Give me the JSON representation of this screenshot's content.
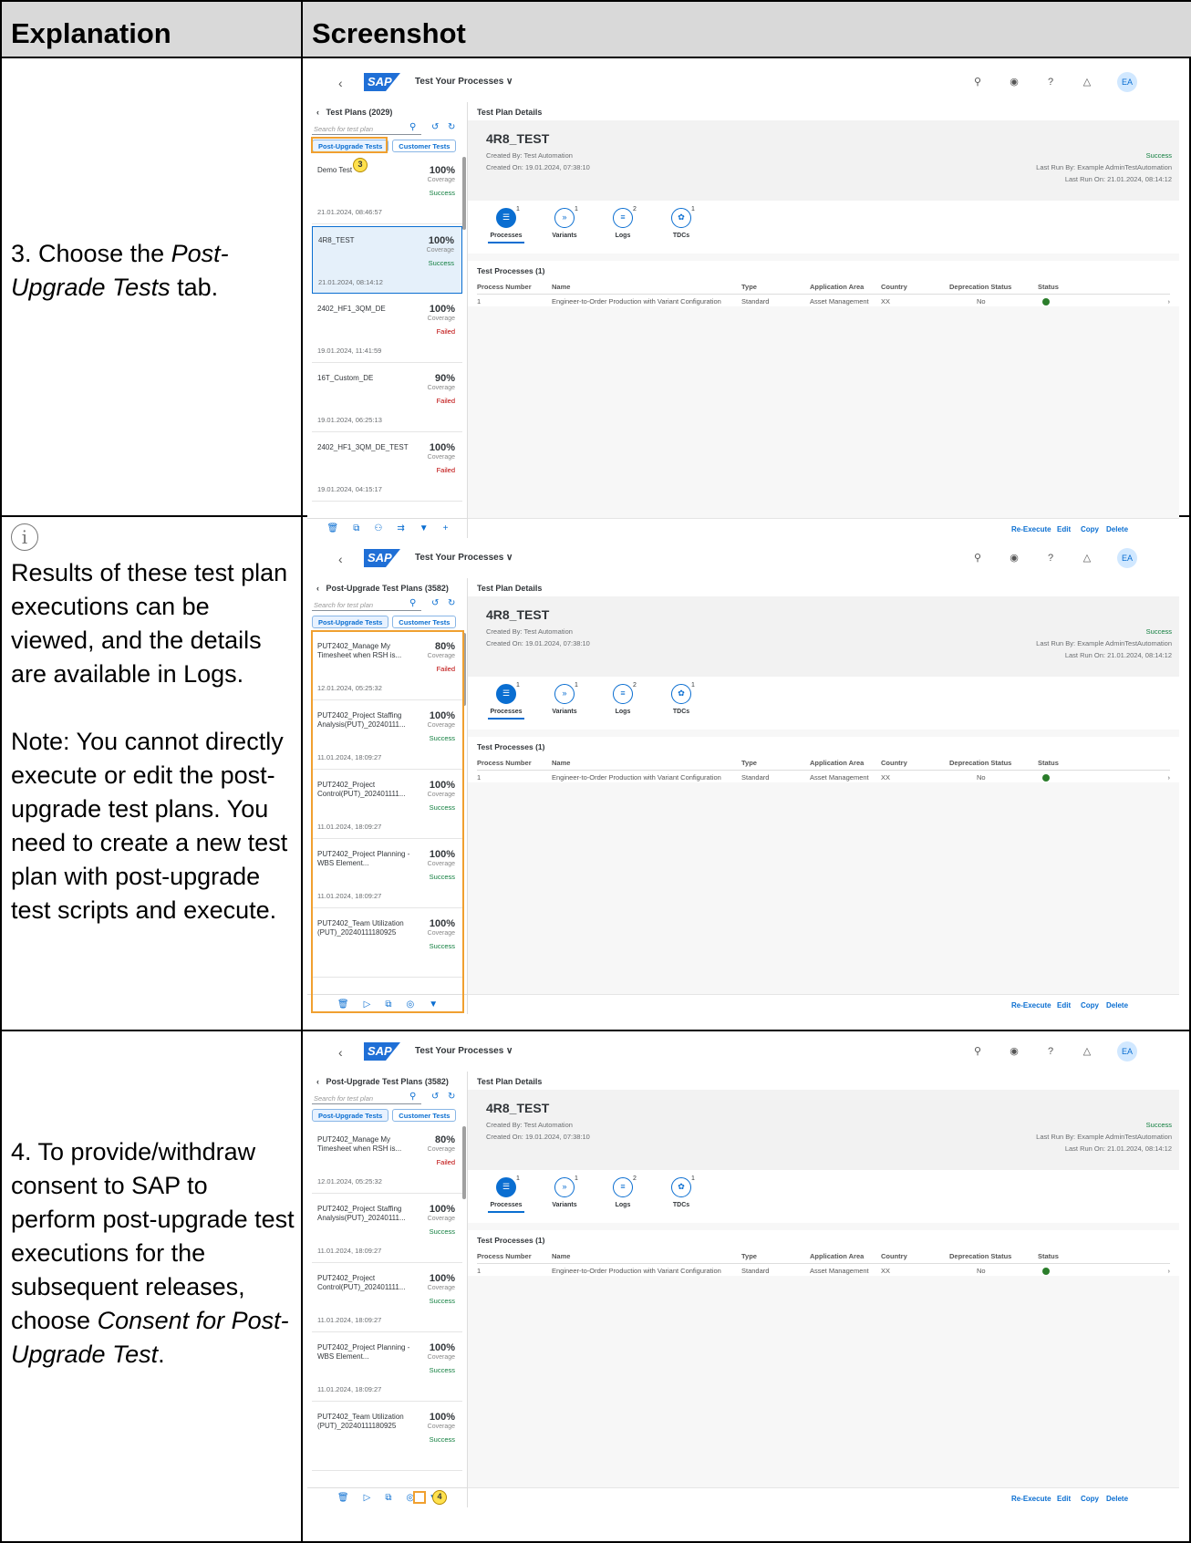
{
  "header": {
    "explanation": "Explanation",
    "screenshot": "Screenshot"
  },
  "rows": [
    {
      "step_prefix": "3. Choose the ",
      "step_em": "Post-Upgrade Tests",
      "step_suffix": " tab."
    },
    {
      "info_icon": "info-icon",
      "p1": "Results of these test plan executions can be viewed, and the details are available in Logs.",
      "p2": "Note: You cannot directly execute or edit the post-upgrade test plans. You need to create a new test plan with post-upgrade test scripts and execute."
    },
    {
      "step_prefix": "4. To provide/withdraw consent to SAP to perform post-upgrade test executions for the subsequent releases, choose ",
      "step_em": "Consent for Post-Upgrade Test",
      "step_suffix": "."
    }
  ],
  "shell": {
    "logo": "SAP",
    "app": "Test Your Processes ∨",
    "avatar": "EA"
  },
  "shot1": {
    "list_title": "Test Plans (2029)",
    "search_placeholder": "Search for test plan",
    "tab1": "Post-Upgrade Tests",
    "tab2": "Customer Tests",
    "callout": "3",
    "items": [
      {
        "name": "Demo Test",
        "pct": "100%",
        "cov": "Coverage",
        "status": "Success",
        "date": "21.01.2024, 08:46:57"
      },
      {
        "name": "4R8_TEST",
        "pct": "100%",
        "cov": "Coverage",
        "status": "Success",
        "date": "21.01.2024, 08:14:12"
      },
      {
        "name": "2402_HF1_3QM_DE",
        "pct": "100%",
        "cov": "Coverage",
        "status": "Failed",
        "date": "19.01.2024, 11:41:59"
      },
      {
        "name": "16T_Custom_DE",
        "pct": "90%",
        "cov": "Coverage",
        "status": "Failed",
        "date": "19.01.2024, 06:25:13"
      },
      {
        "name": "2402_HF1_3QM_DE_TEST",
        "pct": "100%",
        "cov": "Coverage",
        "status": "Failed",
        "date": "19.01.2024, 04:15:17"
      }
    ]
  },
  "shot2": {
    "list_title": "Post-Upgrade Test Plans (3582)",
    "search_placeholder": "Search for test plan",
    "tab1": "Post-Upgrade Tests",
    "tab2": "Customer Tests",
    "callout": "4",
    "items": [
      {
        "name": "PUT2402_Manage My Timesheet when RSH is...",
        "pct": "80%",
        "cov": "Coverage",
        "status": "Failed",
        "date": "12.01.2024, 05:25:32"
      },
      {
        "name": "PUT2402_Project Staffing Analysis(PUT)_20240111...",
        "pct": "100%",
        "cov": "Coverage",
        "status": "Success",
        "date": "11.01.2024, 18:09:27"
      },
      {
        "name": "PUT2402_Project Control(PUT)_202401111...",
        "pct": "100%",
        "cov": "Coverage",
        "status": "Success",
        "date": "11.01.2024, 18:09:27"
      },
      {
        "name": "PUT2402_Project Planning - WBS Element...",
        "pct": "100%",
        "cov": "Coverage",
        "status": "Success",
        "date": "11.01.2024, 18:09:27"
      },
      {
        "name": "PUT2402_Team Utilization (PUT)_20240111180925",
        "pct": "100%",
        "cov": "Coverage",
        "status": "Success",
        "date": ""
      }
    ]
  },
  "details": {
    "header": "Test Plan Details",
    "title": "4R8_TEST",
    "created_by": "Created By: Test Automation",
    "created_on": "Created On: 19.01.2024, 07:38:10",
    "status": "Success",
    "last_run_by": "Last Run By: Example AdminTestAutomation",
    "last_run_on": "Last Run On: 21.01.2024, 08:14:12",
    "tabs": [
      {
        "label": "Processes",
        "count": "1"
      },
      {
        "label": "Variants",
        "count": "1"
      },
      {
        "label": "Logs",
        "count": "2"
      },
      {
        "label": "TDCs",
        "count": "1"
      }
    ],
    "table_title": "Test Processes (1)",
    "columns": [
      "Process Number",
      "Name",
      "Type",
      "Application Area",
      "Country",
      "Deprecation Status",
      "Status"
    ],
    "row": [
      "1",
      "Engineer-to-Order Production with Variant Configuration",
      "Standard",
      "Asset Management",
      "XX",
      "No"
    ],
    "actions": [
      "Re-Execute",
      "Edit",
      "Copy",
      "Delete"
    ]
  }
}
